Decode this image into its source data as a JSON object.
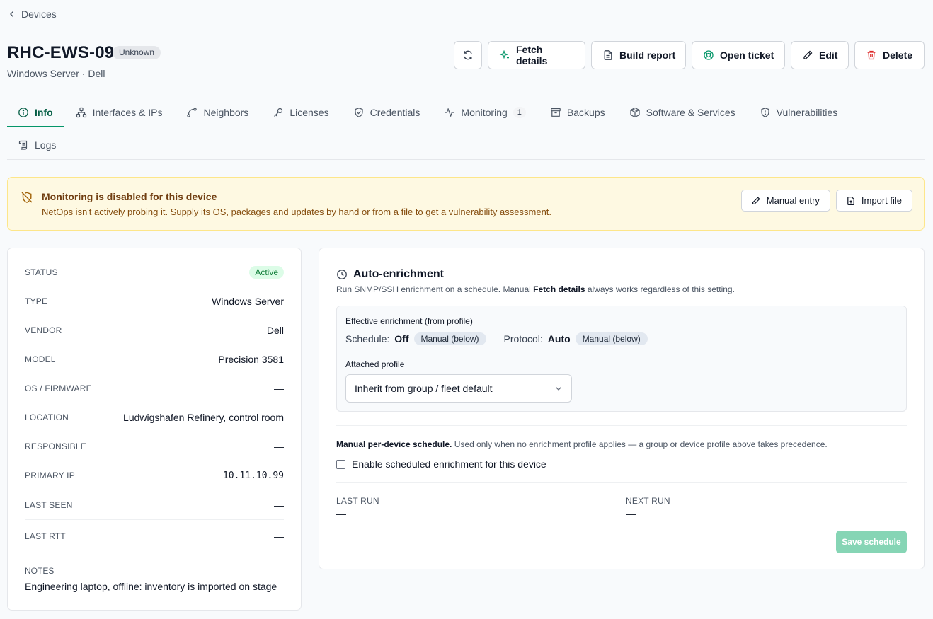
{
  "breadcrumb": {
    "label": "Devices"
  },
  "device": {
    "name": "RHC-EWS-09",
    "badge": "Unknown",
    "subtitle": "Windows Server · Dell"
  },
  "toolbar": {
    "refresh_icon": "refresh-icon",
    "fetch": "Fetch details",
    "report": "Build report",
    "ticket": "Open ticket",
    "edit": "Edit",
    "delete": "Delete"
  },
  "tabs": [
    {
      "label": "Info",
      "icon": "info-icon",
      "active": true
    },
    {
      "label": "Interfaces & IPs",
      "icon": "network-icon"
    },
    {
      "label": "Neighbors",
      "icon": "route-icon"
    },
    {
      "label": "Licenses",
      "icon": "key-icon"
    },
    {
      "label": "Credentials",
      "icon": "shield-icon"
    },
    {
      "label": "Monitoring",
      "icon": "activity-icon",
      "count": "1"
    },
    {
      "label": "Backups",
      "icon": "archive-icon"
    },
    {
      "label": "Software & Services",
      "icon": "package-icon"
    },
    {
      "label": "Vulnerabilities",
      "icon": "shield-alert-icon"
    },
    {
      "label": "Logs",
      "icon": "scroll-icon"
    }
  ],
  "alert": {
    "title": "Monitoring is disabled for this device",
    "text": "NetOps isn't actively probing it. Supply its OS, packages and updates by hand or from a file to get a vulnerability assessment.",
    "manual_entry": "Manual entry",
    "import_file": "Import file"
  },
  "info": {
    "rows": [
      {
        "key": "STATUS",
        "value": "Active"
      },
      {
        "key": "TYPE",
        "value": "Windows Server"
      },
      {
        "key": "VENDOR",
        "value": "Dell"
      },
      {
        "key": "MODEL",
        "value": "Precision 3581"
      },
      {
        "key": "OS / FIRMWARE",
        "value": "—"
      },
      {
        "key": "LOCATION",
        "value": "Ludwigshafen Refinery, control room"
      },
      {
        "key": "RESPONSIBLE",
        "value": "—"
      },
      {
        "key": "PRIMARY IP",
        "value": "10.11.10.99"
      },
      {
        "key": "LAST SEEN",
        "value": "—"
      },
      {
        "key": "LAST RTT",
        "value": "—"
      }
    ],
    "notes_label": "NOTES",
    "notes_value": "Engineering laptop, offline: inventory is imported on stage"
  },
  "enrichment": {
    "title": "Auto-enrichment",
    "desc_prefix": "Run SNMP/SSH enrichment on a schedule. Manual ",
    "desc_bold": "Fetch details",
    "desc_suffix": " always works regardless of this setting.",
    "effective_label": "Effective enrichment (from profile)",
    "schedule_label": "Schedule:",
    "schedule_value": "Off",
    "schedule_chip": "Manual (below)",
    "protocol_label": "Protocol:",
    "protocol_value": "Auto",
    "protocol_chip": "Manual (below)",
    "profile_label": "Attached profile",
    "profile_value": "Inherit from group / fleet default",
    "manual_bold": "Manual per-device schedule.",
    "manual_text": " Used only when no enrichment profile applies — a group or device profile above takes precedence.",
    "checkbox_label": "Enable scheduled enrichment for this device",
    "last_run_label": "LAST RUN",
    "last_run_value": "—",
    "next_run_label": "NEXT RUN",
    "next_run_value": "—",
    "save": "Save schedule"
  },
  "colors": {
    "accent": "#059669",
    "alert_bg": "#fef9e2",
    "delete_red": "#dc2626"
  }
}
